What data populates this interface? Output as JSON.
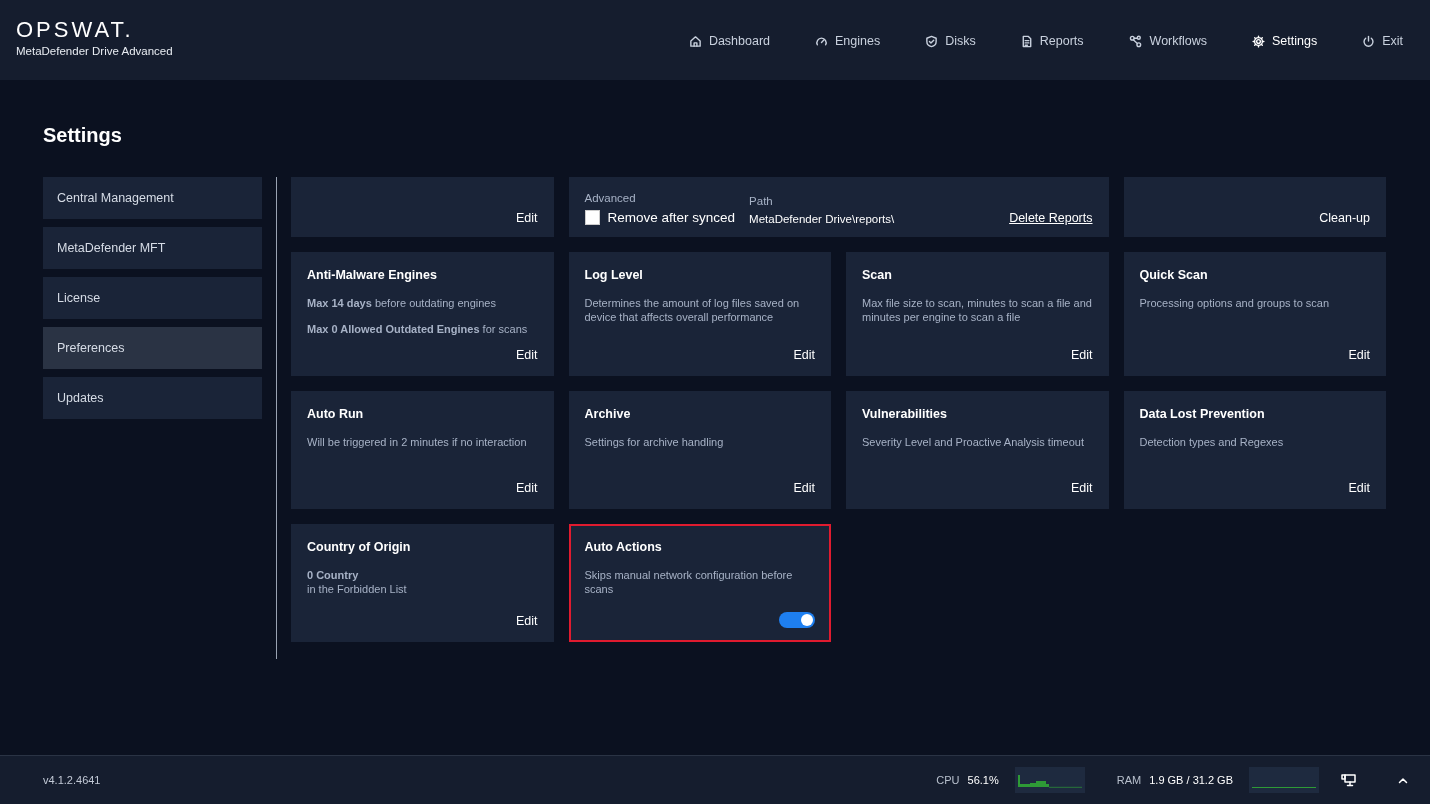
{
  "brand": {
    "logo": "OPSWAT.",
    "product": "MetaDefender Drive Advanced"
  },
  "nav": [
    {
      "label": "Dashboard",
      "selected": false
    },
    {
      "label": "Engines",
      "selected": false
    },
    {
      "label": "Disks",
      "selected": false
    },
    {
      "label": "Reports",
      "selected": false
    },
    {
      "label": "Workflows",
      "selected": false
    },
    {
      "label": "Settings",
      "selected": true
    },
    {
      "label": "Exit",
      "selected": false
    }
  ],
  "page_title": "Settings",
  "sidebar": {
    "items": [
      {
        "label": "Central Management",
        "selected": false
      },
      {
        "label": "MetaDefender MFT",
        "selected": false
      },
      {
        "label": "License",
        "selected": false
      },
      {
        "label": "Preferences",
        "selected": true
      },
      {
        "label": "Updates",
        "selected": false
      }
    ]
  },
  "cards": [
    {
      "kind": "edit",
      "action": "Edit",
      "highlighted": false
    },
    {
      "kind": "reports",
      "advanced_label": "Advanced",
      "checkbox": {
        "label": "Remove after synced",
        "checked": false
      },
      "path_label": "Path",
      "path": "MetaDefender Drive\\reports\\",
      "action": "Delete Reports",
      "highlighted": false
    },
    {
      "kind": "edit",
      "action": "Clean-up",
      "highlighted": false
    },
    {
      "kind": "edit",
      "title": "Anti-Malware Engines",
      "lines": [
        "**Max 14 days** before outdating engines",
        "**Max 0 Allowed Outdated Engines** for scans"
      ],
      "action": "Edit",
      "highlighted": false
    },
    {
      "kind": "edit",
      "title": "Log Level",
      "lines": [
        "Determines the amount of log files saved on device that affects overall performance"
      ],
      "action": "Edit",
      "highlighted": false
    },
    {
      "kind": "edit",
      "title": "Scan",
      "lines": [
        "Max file size to scan, minutes to scan a file and minutes per engine to scan a file"
      ],
      "action": "Edit",
      "highlighted": false
    },
    {
      "kind": "edit",
      "title": "Quick Scan",
      "lines": [
        "Processing options and groups to scan"
      ],
      "action": "Edit",
      "highlighted": false
    },
    {
      "kind": "edit",
      "title": "Auto Run",
      "lines": [
        "Will be triggered in 2 minutes if no interaction"
      ],
      "action": "Edit",
      "highlighted": false
    },
    {
      "kind": "edit",
      "title": "Archive",
      "lines": [
        "Settings for archive handling"
      ],
      "action": "Edit",
      "highlighted": false
    },
    {
      "kind": "edit",
      "title": "Vulnerabilities",
      "lines": [
        "Severity Level and Proactive Analysis timeout"
      ],
      "action": "Edit",
      "highlighted": false
    },
    {
      "kind": "edit",
      "title": "Data Lost Prevention",
      "lines": [
        "Detection types and Regexes"
      ],
      "action": "Edit",
      "highlighted": false
    },
    {
      "kind": "edit",
      "title": "Country of Origin",
      "lines": [
        "**0 Country**\nin the Forbidden List"
      ],
      "action": "Edit",
      "highlighted": false
    },
    {
      "kind": "toggle",
      "title": "Auto Actions",
      "lines": [
        "Skips manual network configuration before scans"
      ],
      "on": true,
      "highlighted": true
    }
  ],
  "status_bar": {
    "version": "v4.1.2.4641",
    "cpu_label": "CPU",
    "cpu_value": "56.1%",
    "ram_label": "RAM",
    "ram_value": "1.9 GB / 31.2 GB"
  }
}
